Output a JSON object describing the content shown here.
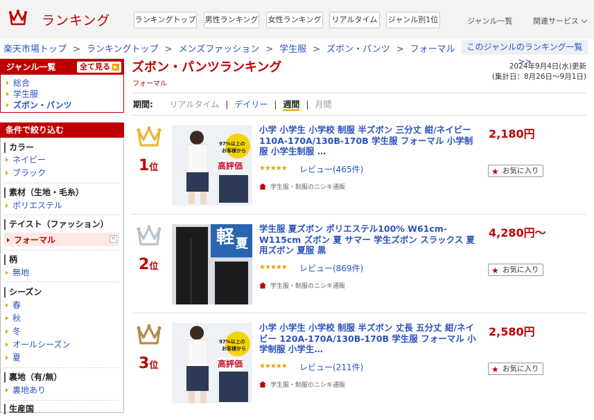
{
  "header": {
    "logo_text": "ランキング",
    "nav_buttons": [
      "ランキングトップ",
      "男性ランキング",
      "女性ランキング",
      "リアルタイム",
      "ジャンル別1位"
    ],
    "genre_list_link": "ジャンル一覧",
    "related_services": "関連サービス"
  },
  "breadcrumb": [
    "楽天市場トップ",
    "ランキングトップ",
    "メンズファッション",
    "学生服",
    "ズボン・パンツ",
    "フォーマル"
  ],
  "breadcrumb_sep": ">",
  "genre_ranking_list": "このジャンルのランキング一覧 >>",
  "sidebar": {
    "genre_title": "ジャンル一覧",
    "see_all": "全て見る",
    "genres": [
      "総合",
      "学生服",
      "ズボン・パンツ"
    ],
    "filter_title": "条件で絞り込む",
    "filters": {
      "color": {
        "label": "カラー",
        "items": [
          "ネイビー",
          "ブラック"
        ]
      },
      "material": {
        "label": "素材（生地・毛糸）",
        "items": [
          "ポリエステル"
        ]
      },
      "taste": {
        "label": "テイスト（ファッション）",
        "items": [
          "フォーマル"
        ],
        "clear": "×"
      },
      "pattern": {
        "label": "柄",
        "items": [
          "無地"
        ]
      },
      "season": {
        "label": "シーズン",
        "items": [
          "春",
          "秋",
          "冬",
          "オールシーズン",
          "夏"
        ]
      },
      "lining": {
        "label": "裏地（有/無）",
        "items": [
          "裏地あり"
        ]
      },
      "origin": {
        "label": "生産国"
      }
    }
  },
  "main": {
    "title": "ズボン・パンツランキング",
    "subgenre": "フォーマル",
    "updated_line1": "2024年9月4日(水)更新",
    "updated_line2": "(集計日：8月26日〜9月1日)",
    "period_label": "期間:",
    "periods": [
      "リアルタイム",
      "デイリー",
      "週間",
      "月間"
    ],
    "period_sep": "|"
  },
  "items": [
    {
      "rank": "1",
      "rank_suffix": "位",
      "name": "小学 小学生 小学校 制服 半ズボン 三分丈 紺/ネイビー 110A-170A/130B-170B 学生服 フォーマル 小学制服 小学生制服 …",
      "stars": "★★★★★",
      "review": "レビュー(465件)",
      "shop": "学生服・制服のニシキ通販",
      "price": "2,180円",
      "fav": "お気に入り",
      "badge_top": "97%以上の",
      "badge_mid": "お客様から",
      "badge_main": "高評価",
      "crown_color": "#e8b83a"
    },
    {
      "rank": "2",
      "rank_suffix": "位",
      "name": "学生服 夏ズボン ポリエステル100% W61cm-W115cm ズボン 夏 サマー 学生ズボン スラックス 夏用ズボン 夏服 黒",
      "stars": "★★★★★",
      "review": "レビュー(869件)",
      "shop": "学生服・制服のニシキ通販",
      "price": "4,280円〜",
      "fav": "お気に入り",
      "badge_main": "夏",
      "badge_sub": "軽",
      "crown_color": "#b6c3cf"
    },
    {
      "rank": "3",
      "rank_suffix": "位",
      "name": "小学 小学生 小学校 制服 半ズボン 丈長 五分丈 紺/ネイビー 120A-170A/130B-170B 学生服 フォーマル 小学制服 小学生…",
      "stars": "★★★★★",
      "review": "レビュー(211件)",
      "shop": "学生服・制服のニシキ通販",
      "price": "2,580円",
      "fav": "お気に入り",
      "badge_top": "97%以上の",
      "badge_mid": "お客様から",
      "badge_main": "高評価",
      "crown_color": "#b58a4a"
    }
  ]
}
